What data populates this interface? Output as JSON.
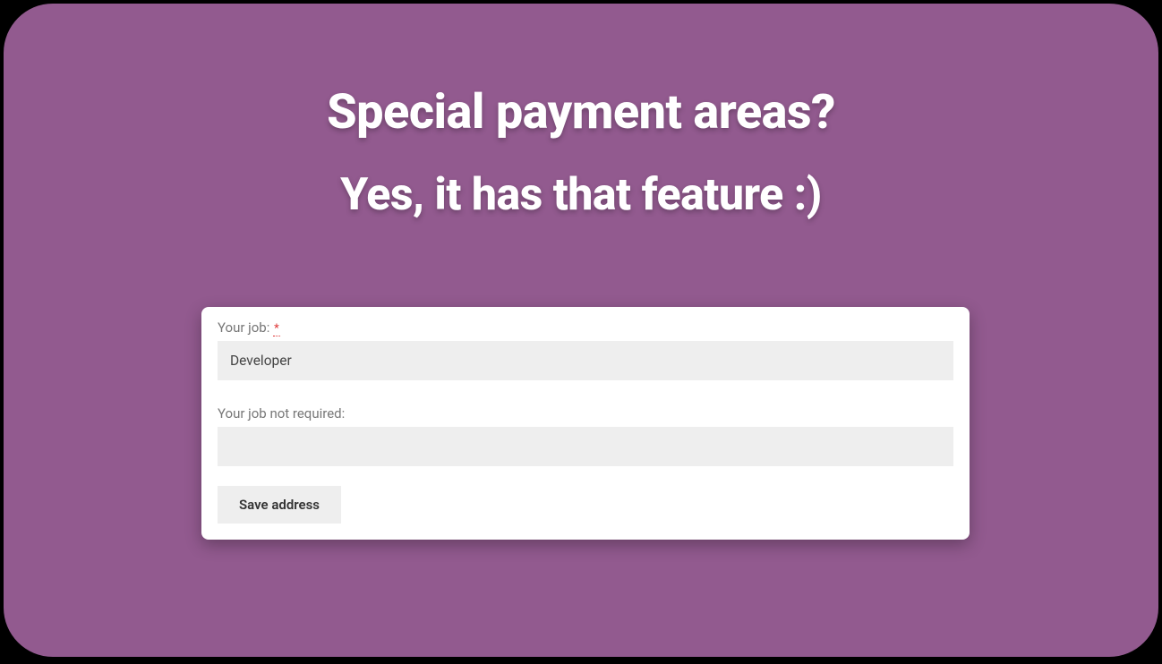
{
  "heading": {
    "line1": "Special payment areas?",
    "line2": "Yes, it has that feature :)"
  },
  "form": {
    "field1": {
      "label": "Your job: ",
      "required_mark": "*",
      "value": "Developer"
    },
    "field2": {
      "label": "Your job not required:",
      "value": ""
    },
    "save_button": "Save address"
  }
}
